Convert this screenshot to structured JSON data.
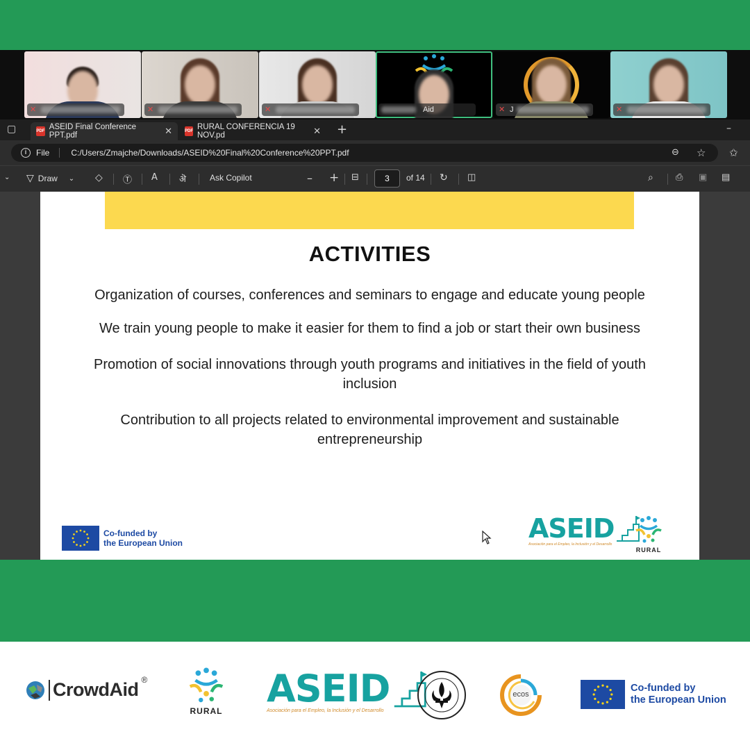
{
  "participants": [
    {
      "name_label": "",
      "active": false
    },
    {
      "name_label": "",
      "active": false
    },
    {
      "name_label": "",
      "active": false
    },
    {
      "name_label": "Aid",
      "active": true
    },
    {
      "name_label": "J",
      "active": false
    },
    {
      "name_label": "",
      "active": false
    }
  ],
  "browser": {
    "tabs": [
      {
        "label": "ASEID Final Conference PPT.pdf",
        "active": true
      },
      {
        "label": "RURAL CONFERENCIA 19 NOV.pd",
        "active": false
      }
    ],
    "address": {
      "scheme_label": "File",
      "url": "C:/Users/Zmajche/Downloads/ASEID%20Final%20Conference%20PPT.pdf"
    }
  },
  "pdf_toolbar": {
    "draw_label": "Draw",
    "copilot_label": "Ask Copilot",
    "current_page": "3",
    "page_total": "of 14"
  },
  "slide": {
    "title": "ACTIVITIES",
    "bullets": [
      "Organization of courses, conferences and seminars to engage and educate young people",
      "We train young people to make it easier for them to find a job or start their own business",
      "Promotion of social innovations through youth programs and initiatives in the field of youth inclusion",
      "Contribution to all projects related to environmental improvement and sustainable entrepreneurship"
    ],
    "eu_line1": "Co-funded by",
    "eu_line2": "the European Union",
    "aseid_logo": "ASEID",
    "aseid_tagline": "Asociación para el Empleo, la Inclusión y el Desarrollo",
    "rural_logo": "RURAL"
  },
  "footer": {
    "crowdaid": "CrowdAid",
    "crowdaid_mark": "®",
    "rural": "RURAL",
    "aseid": "ASEID",
    "aseid_tagline": "Asociación para el Empleo, la Inclusión y el Desarrollo",
    "scout_ring_text": "ASOCIATIA SCOUT SOCIETY",
    "ecos": "ecos",
    "eu_line1": "Co-funded by",
    "eu_line2": "the European Union"
  },
  "colors": {
    "green_band": "#239a56",
    "accent_yellow": "#fcd94f",
    "eu_blue": "#1d4aa3",
    "aseid_teal": "#17a2a0"
  }
}
